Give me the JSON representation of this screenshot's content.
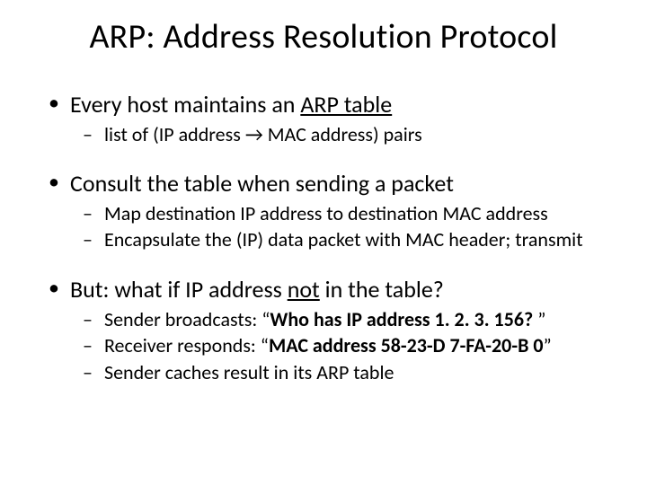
{
  "title": "ARP: Address Resolution Protocol",
  "b1": {
    "pre": "Every host maintains an ",
    "u": "ARP table",
    "sub1_pre": "list of (IP address ",
    "sub1_arrow": "→",
    "sub1_post": " MAC address) pairs"
  },
  "b2": {
    "text": "Consult the table when sending a packet",
    "sub1": "Map destination IP address to destination MAC address",
    "sub2": "Encapsulate the (IP) data packet with MAC header; transmit"
  },
  "b3": {
    "pre": "But: what if IP address ",
    "u": "not",
    "post": " in the table?",
    "sub1_pre": "Sender broadcasts: ",
    "sub1_lq": "“",
    "sub1_q": "Who has IP address 1. 2. 3. 156? ",
    "sub1_rq": "”",
    "sub2_pre": "Receiver responds: ",
    "sub2_lq": "“",
    "sub2_q": "MAC address 58-23-D 7-FA-20-B 0",
    "sub2_rq": "”",
    "sub3": "Sender caches result in its ARP table"
  }
}
